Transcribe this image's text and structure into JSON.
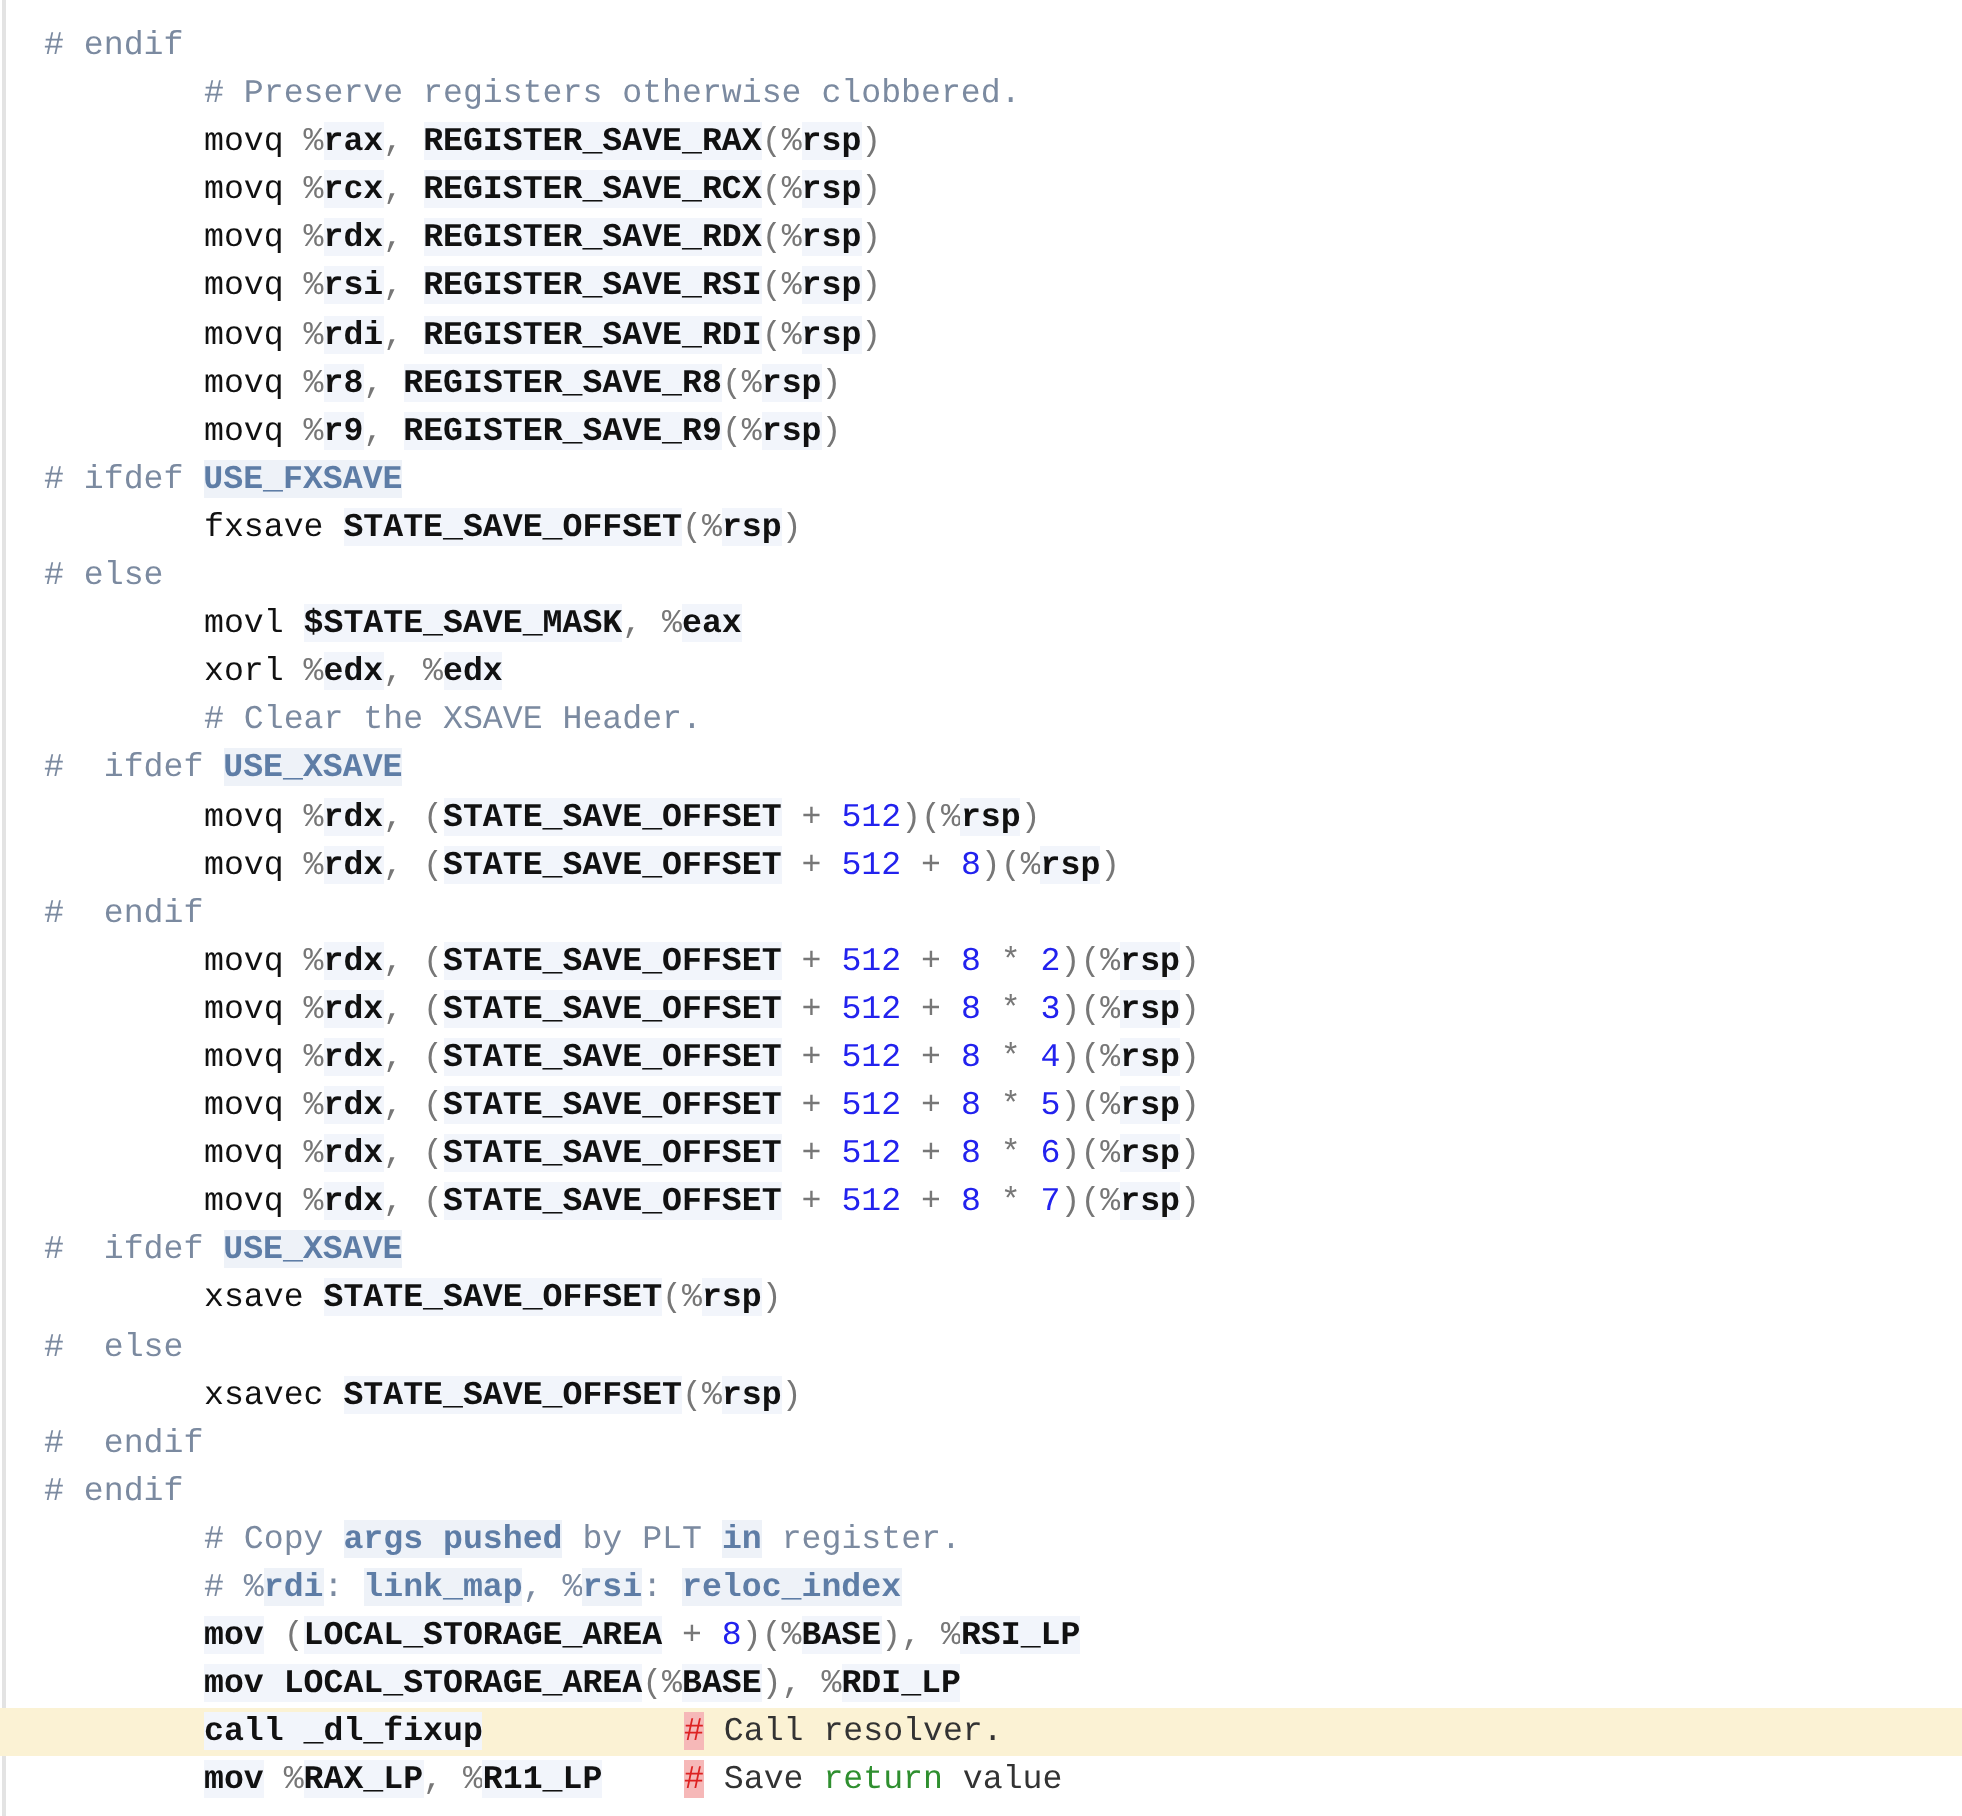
{
  "lines": [
    {
      "indented": false,
      "current": false,
      "tokens": [
        {
          "kind": "comment",
          "text": "# endif"
        }
      ]
    },
    {
      "indented": true,
      "current": false,
      "tokens": [
        {
          "kind": "comment",
          "text": "# Preserve registers otherwise clobbered."
        }
      ]
    },
    {
      "indented": true,
      "current": false,
      "tokens": [
        {
          "kind": "plain",
          "text": "movq "
        },
        {
          "kind": "punct",
          "text": "%"
        },
        {
          "kind": "ident",
          "text": "rax"
        },
        {
          "kind": "punct",
          "text": ", "
        },
        {
          "kind": "ident",
          "text": "REGISTER_SAVE_RAX"
        },
        {
          "kind": "punct",
          "text": "(%"
        },
        {
          "kind": "ident",
          "text": "rsp"
        },
        {
          "kind": "punct",
          "text": ")"
        }
      ]
    },
    {
      "indented": true,
      "current": false,
      "tokens": [
        {
          "kind": "plain",
          "text": "movq "
        },
        {
          "kind": "punct",
          "text": "%"
        },
        {
          "kind": "ident",
          "text": "rcx"
        },
        {
          "kind": "punct",
          "text": ", "
        },
        {
          "kind": "ident",
          "text": "REGISTER_SAVE_RCX"
        },
        {
          "kind": "punct",
          "text": "(%"
        },
        {
          "kind": "ident",
          "text": "rsp"
        },
        {
          "kind": "punct",
          "text": ")"
        }
      ]
    },
    {
      "indented": true,
      "current": false,
      "tokens": [
        {
          "kind": "plain",
          "text": "movq "
        },
        {
          "kind": "punct",
          "text": "%"
        },
        {
          "kind": "ident",
          "text": "rdx"
        },
        {
          "kind": "punct",
          "text": ", "
        },
        {
          "kind": "ident",
          "text": "REGISTER_SAVE_RDX"
        },
        {
          "kind": "punct",
          "text": "(%"
        },
        {
          "kind": "ident",
          "text": "rsp"
        },
        {
          "kind": "punct",
          "text": ")"
        }
      ]
    },
    {
      "indented": true,
      "current": false,
      "tokens": [
        {
          "kind": "plain",
          "text": "movq "
        },
        {
          "kind": "punct",
          "text": "%"
        },
        {
          "kind": "ident",
          "text": "rsi"
        },
        {
          "kind": "punct",
          "text": ", "
        },
        {
          "kind": "ident",
          "text": "REGISTER_SAVE_RSI"
        },
        {
          "kind": "punct",
          "text": "(%"
        },
        {
          "kind": "ident",
          "text": "rsp"
        },
        {
          "kind": "punct",
          "text": ")"
        }
      ]
    },
    {
      "indented": true,
      "current": false,
      "tokens": [
        {
          "kind": "plain",
          "text": "movq "
        },
        {
          "kind": "punct",
          "text": "%"
        },
        {
          "kind": "ident",
          "text": "rdi"
        },
        {
          "kind": "punct",
          "text": ", "
        },
        {
          "kind": "ident",
          "text": "REGISTER_SAVE_RDI"
        },
        {
          "kind": "punct",
          "text": "(%"
        },
        {
          "kind": "ident",
          "text": "rsp"
        },
        {
          "kind": "punct",
          "text": ")"
        }
      ]
    },
    {
      "indented": true,
      "current": false,
      "tokens": [
        {
          "kind": "plain",
          "text": "movq "
        },
        {
          "kind": "punct",
          "text": "%"
        },
        {
          "kind": "ident",
          "text": "r8"
        },
        {
          "kind": "punct",
          "text": ", "
        },
        {
          "kind": "ident",
          "text": "REGISTER_SAVE_R8"
        },
        {
          "kind": "punct",
          "text": "(%"
        },
        {
          "kind": "ident",
          "text": "rsp"
        },
        {
          "kind": "punct",
          "text": ")"
        }
      ]
    },
    {
      "indented": true,
      "current": false,
      "tokens": [
        {
          "kind": "plain",
          "text": "movq "
        },
        {
          "kind": "punct",
          "text": "%"
        },
        {
          "kind": "ident",
          "text": "r9"
        },
        {
          "kind": "punct",
          "text": ", "
        },
        {
          "kind": "ident",
          "text": "REGISTER_SAVE_R9"
        },
        {
          "kind": "punct",
          "text": "(%"
        },
        {
          "kind": "ident",
          "text": "rsp"
        },
        {
          "kind": "punct",
          "text": ")"
        }
      ]
    },
    {
      "indented": false,
      "current": false,
      "tokens": [
        {
          "kind": "comment",
          "text": "# ifdef "
        },
        {
          "kind": "macro",
          "text": "USE_FXSAVE"
        }
      ]
    },
    {
      "indented": true,
      "current": false,
      "tokens": [
        {
          "kind": "plain",
          "text": "fxsave "
        },
        {
          "kind": "ident",
          "text": "STATE_SAVE_OFFSET"
        },
        {
          "kind": "punct",
          "text": "(%"
        },
        {
          "kind": "ident",
          "text": "rsp"
        },
        {
          "kind": "punct",
          "text": ")"
        }
      ]
    },
    {
      "indented": false,
      "current": false,
      "tokens": [
        {
          "kind": "comment",
          "text": "# else"
        }
      ]
    },
    {
      "indented": true,
      "current": false,
      "tokens": [
        {
          "kind": "plain",
          "text": "movl "
        },
        {
          "kind": "ident",
          "text": "$STATE_SAVE_MASK"
        },
        {
          "kind": "punct",
          "text": ", %"
        },
        {
          "kind": "ident",
          "text": "eax"
        }
      ]
    },
    {
      "indented": true,
      "current": false,
      "tokens": [
        {
          "kind": "plain",
          "text": "xorl "
        },
        {
          "kind": "punct",
          "text": "%"
        },
        {
          "kind": "ident",
          "text": "edx"
        },
        {
          "kind": "punct",
          "text": ", %"
        },
        {
          "kind": "ident",
          "text": "edx"
        }
      ]
    },
    {
      "indented": true,
      "current": false,
      "tokens": [
        {
          "kind": "comment",
          "text": "# Clear the XSAVE Header."
        }
      ]
    },
    {
      "indented": false,
      "current": false,
      "tokens": [
        {
          "kind": "comment",
          "text": "#  ifdef "
        },
        {
          "kind": "macro",
          "text": "USE_XSAVE"
        }
      ]
    },
    {
      "indented": true,
      "current": false,
      "tokens": [
        {
          "kind": "plain",
          "text": "movq "
        },
        {
          "kind": "punct",
          "text": "%"
        },
        {
          "kind": "ident",
          "text": "rdx"
        },
        {
          "kind": "punct",
          "text": ", ("
        },
        {
          "kind": "ident",
          "text": "STATE_SAVE_OFFSET"
        },
        {
          "kind": "punct",
          "text": " + "
        },
        {
          "kind": "number",
          "text": "512"
        },
        {
          "kind": "punct",
          "text": ")(%"
        },
        {
          "kind": "ident",
          "text": "rsp"
        },
        {
          "kind": "punct",
          "text": ")"
        }
      ]
    },
    {
      "indented": true,
      "current": false,
      "tokens": [
        {
          "kind": "plain",
          "text": "movq "
        },
        {
          "kind": "punct",
          "text": "%"
        },
        {
          "kind": "ident",
          "text": "rdx"
        },
        {
          "kind": "punct",
          "text": ", ("
        },
        {
          "kind": "ident",
          "text": "STATE_SAVE_OFFSET"
        },
        {
          "kind": "punct",
          "text": " + "
        },
        {
          "kind": "number",
          "text": "512"
        },
        {
          "kind": "punct",
          "text": " + "
        },
        {
          "kind": "number",
          "text": "8"
        },
        {
          "kind": "punct",
          "text": ")(%"
        },
        {
          "kind": "ident",
          "text": "rsp"
        },
        {
          "kind": "punct",
          "text": ")"
        }
      ]
    },
    {
      "indented": false,
      "current": false,
      "tokens": [
        {
          "kind": "comment",
          "text": "#  endif"
        }
      ]
    },
    {
      "indented": true,
      "current": false,
      "tokens": [
        {
          "kind": "plain",
          "text": "movq "
        },
        {
          "kind": "punct",
          "text": "%"
        },
        {
          "kind": "ident",
          "text": "rdx"
        },
        {
          "kind": "punct",
          "text": ", ("
        },
        {
          "kind": "ident",
          "text": "STATE_SAVE_OFFSET"
        },
        {
          "kind": "punct",
          "text": " + "
        },
        {
          "kind": "number",
          "text": "512"
        },
        {
          "kind": "punct",
          "text": " + "
        },
        {
          "kind": "number",
          "text": "8"
        },
        {
          "kind": "punct",
          "text": " * "
        },
        {
          "kind": "number",
          "text": "2"
        },
        {
          "kind": "punct",
          "text": ")(%"
        },
        {
          "kind": "ident",
          "text": "rsp"
        },
        {
          "kind": "punct",
          "text": ")"
        }
      ]
    },
    {
      "indented": true,
      "current": false,
      "tokens": [
        {
          "kind": "plain",
          "text": "movq "
        },
        {
          "kind": "punct",
          "text": "%"
        },
        {
          "kind": "ident",
          "text": "rdx"
        },
        {
          "kind": "punct",
          "text": ", ("
        },
        {
          "kind": "ident",
          "text": "STATE_SAVE_OFFSET"
        },
        {
          "kind": "punct",
          "text": " + "
        },
        {
          "kind": "number",
          "text": "512"
        },
        {
          "kind": "punct",
          "text": " + "
        },
        {
          "kind": "number",
          "text": "8"
        },
        {
          "kind": "punct",
          "text": " * "
        },
        {
          "kind": "number",
          "text": "3"
        },
        {
          "kind": "punct",
          "text": ")(%"
        },
        {
          "kind": "ident",
          "text": "rsp"
        },
        {
          "kind": "punct",
          "text": ")"
        }
      ]
    },
    {
      "indented": true,
      "current": false,
      "tokens": [
        {
          "kind": "plain",
          "text": "movq "
        },
        {
          "kind": "punct",
          "text": "%"
        },
        {
          "kind": "ident",
          "text": "rdx"
        },
        {
          "kind": "punct",
          "text": ", ("
        },
        {
          "kind": "ident",
          "text": "STATE_SAVE_OFFSET"
        },
        {
          "kind": "punct",
          "text": " + "
        },
        {
          "kind": "number",
          "text": "512"
        },
        {
          "kind": "punct",
          "text": " + "
        },
        {
          "kind": "number",
          "text": "8"
        },
        {
          "kind": "punct",
          "text": " * "
        },
        {
          "kind": "number",
          "text": "4"
        },
        {
          "kind": "punct",
          "text": ")(%"
        },
        {
          "kind": "ident",
          "text": "rsp"
        },
        {
          "kind": "punct",
          "text": ")"
        }
      ]
    },
    {
      "indented": true,
      "current": false,
      "tokens": [
        {
          "kind": "plain",
          "text": "movq "
        },
        {
          "kind": "punct",
          "text": "%"
        },
        {
          "kind": "ident",
          "text": "rdx"
        },
        {
          "kind": "punct",
          "text": ", ("
        },
        {
          "kind": "ident",
          "text": "STATE_SAVE_OFFSET"
        },
        {
          "kind": "punct",
          "text": " + "
        },
        {
          "kind": "number",
          "text": "512"
        },
        {
          "kind": "punct",
          "text": " + "
        },
        {
          "kind": "number",
          "text": "8"
        },
        {
          "kind": "punct",
          "text": " * "
        },
        {
          "kind": "number",
          "text": "5"
        },
        {
          "kind": "punct",
          "text": ")(%"
        },
        {
          "kind": "ident",
          "text": "rsp"
        },
        {
          "kind": "punct",
          "text": ")"
        }
      ]
    },
    {
      "indented": true,
      "current": false,
      "tokens": [
        {
          "kind": "plain",
          "text": "movq "
        },
        {
          "kind": "punct",
          "text": "%"
        },
        {
          "kind": "ident",
          "text": "rdx"
        },
        {
          "kind": "punct",
          "text": ", ("
        },
        {
          "kind": "ident",
          "text": "STATE_SAVE_OFFSET"
        },
        {
          "kind": "punct",
          "text": " + "
        },
        {
          "kind": "number",
          "text": "512"
        },
        {
          "kind": "punct",
          "text": " + "
        },
        {
          "kind": "number",
          "text": "8"
        },
        {
          "kind": "punct",
          "text": " * "
        },
        {
          "kind": "number",
          "text": "6"
        },
        {
          "kind": "punct",
          "text": ")(%"
        },
        {
          "kind": "ident",
          "text": "rsp"
        },
        {
          "kind": "punct",
          "text": ")"
        }
      ]
    },
    {
      "indented": true,
      "current": false,
      "tokens": [
        {
          "kind": "plain",
          "text": "movq "
        },
        {
          "kind": "punct",
          "text": "%"
        },
        {
          "kind": "ident",
          "text": "rdx"
        },
        {
          "kind": "punct",
          "text": ", ("
        },
        {
          "kind": "ident",
          "text": "STATE_SAVE_OFFSET"
        },
        {
          "kind": "punct",
          "text": " + "
        },
        {
          "kind": "number",
          "text": "512"
        },
        {
          "kind": "punct",
          "text": " + "
        },
        {
          "kind": "number",
          "text": "8"
        },
        {
          "kind": "punct",
          "text": " * "
        },
        {
          "kind": "number",
          "text": "7"
        },
        {
          "kind": "punct",
          "text": ")(%"
        },
        {
          "kind": "ident",
          "text": "rsp"
        },
        {
          "kind": "punct",
          "text": ")"
        }
      ]
    },
    {
      "indented": false,
      "current": false,
      "tokens": [
        {
          "kind": "comment",
          "text": "#  ifdef "
        },
        {
          "kind": "macro",
          "text": "USE_XSAVE"
        }
      ]
    },
    {
      "indented": true,
      "current": false,
      "tokens": [
        {
          "kind": "plain",
          "text": "xsave "
        },
        {
          "kind": "ident",
          "text": "STATE_SAVE_OFFSET"
        },
        {
          "kind": "punct",
          "text": "(%"
        },
        {
          "kind": "ident",
          "text": "rsp"
        },
        {
          "kind": "punct",
          "text": ")"
        }
      ]
    },
    {
      "indented": false,
      "current": false,
      "tokens": [
        {
          "kind": "comment",
          "text": "#  else"
        }
      ]
    },
    {
      "indented": true,
      "current": false,
      "tokens": [
        {
          "kind": "plain",
          "text": "xsavec "
        },
        {
          "kind": "ident",
          "text": "STATE_SAVE_OFFSET"
        },
        {
          "kind": "punct",
          "text": "(%"
        },
        {
          "kind": "ident",
          "text": "rsp"
        },
        {
          "kind": "punct",
          "text": ")"
        }
      ]
    },
    {
      "indented": false,
      "current": false,
      "tokens": [
        {
          "kind": "comment",
          "text": "#  endif"
        }
      ]
    },
    {
      "indented": false,
      "current": false,
      "tokens": [
        {
          "kind": "comment",
          "text": "# endif"
        }
      ]
    },
    {
      "indented": true,
      "current": false,
      "tokens": [
        {
          "kind": "comment",
          "text": "# Copy "
        },
        {
          "kind": "macro",
          "text": "args pushed"
        },
        {
          "kind": "comment",
          "text": " by PLT "
        },
        {
          "kind": "macro",
          "text": "in"
        },
        {
          "kind": "comment",
          "text": " register."
        }
      ]
    },
    {
      "indented": true,
      "current": false,
      "tokens": [
        {
          "kind": "comment",
          "text": "# %"
        },
        {
          "kind": "macro",
          "text": "rdi"
        },
        {
          "kind": "comment",
          "text": ": "
        },
        {
          "kind": "macro",
          "text": "link_map"
        },
        {
          "kind": "comment",
          "text": ", %"
        },
        {
          "kind": "macro",
          "text": "rsi"
        },
        {
          "kind": "comment",
          "text": ": "
        },
        {
          "kind": "macro",
          "text": "reloc_index"
        }
      ]
    },
    {
      "indented": true,
      "current": false,
      "tokens": [
        {
          "kind": "ident",
          "text": "mov"
        },
        {
          "kind": "punct",
          "text": " ("
        },
        {
          "kind": "ident",
          "text": "LOCAL_STORAGE_AREA"
        },
        {
          "kind": "punct",
          "text": " + "
        },
        {
          "kind": "number",
          "text": "8"
        },
        {
          "kind": "punct",
          "text": ")(%"
        },
        {
          "kind": "ident",
          "text": "BASE"
        },
        {
          "kind": "punct",
          "text": "), %"
        },
        {
          "kind": "ident",
          "text": "RSI_LP"
        }
      ]
    },
    {
      "indented": true,
      "current": false,
      "tokens": [
        {
          "kind": "ident",
          "text": "mov "
        },
        {
          "kind": "ident",
          "text": "LOCAL_STORAGE_AREA"
        },
        {
          "kind": "punct",
          "text": "(%"
        },
        {
          "kind": "ident",
          "text": "BASE"
        },
        {
          "kind": "punct",
          "text": "), %"
        },
        {
          "kind": "ident",
          "text": "RDI_LP"
        }
      ]
    },
    {
      "indented": true,
      "current": true,
      "tokens": [
        {
          "kind": "ident",
          "text": "call "
        },
        {
          "kind": "ident",
          "text": "_dl_fixup"
        }
      ],
      "comment_tokens": [
        {
          "kind": "marker",
          "text": "#"
        },
        {
          "kind": "trailing",
          "text": " Call resolver."
        }
      ]
    },
    {
      "indented": true,
      "current": false,
      "tokens": [
        {
          "kind": "ident",
          "text": "mov"
        },
        {
          "kind": "punct",
          "text": " %"
        },
        {
          "kind": "ident",
          "text": "RAX_LP"
        },
        {
          "kind": "punct",
          "text": ", %"
        },
        {
          "kind": "ident",
          "text": "R11_LP"
        }
      ],
      "comment_tokens": [
        {
          "kind": "marker",
          "text": "#"
        },
        {
          "kind": "trailing",
          "text": " Save "
        },
        {
          "kind": "keyword",
          "text": "return"
        },
        {
          "kind": "trailing",
          "text": " value"
        }
      ]
    }
  ]
}
